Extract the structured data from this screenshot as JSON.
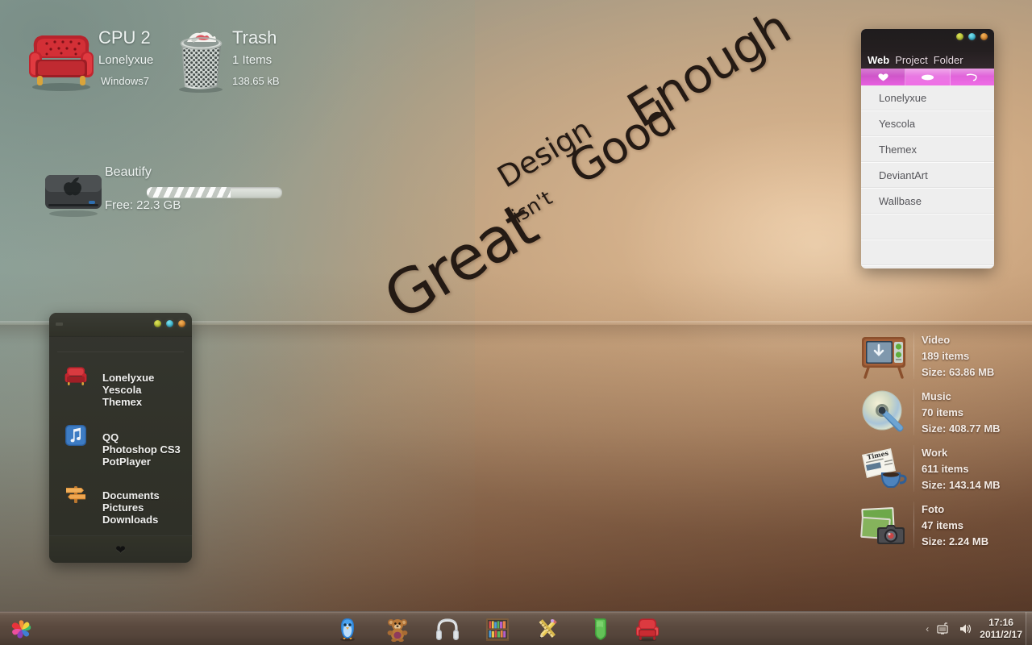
{
  "wallpaper": {
    "line_great": "Great",
    "line_design": "Design",
    "line_isnt": "isn't",
    "line_good": "Good",
    "line_enough": "Enough"
  },
  "desktop_widgets": {
    "cpu": {
      "icon": "armchair-icon",
      "title": "CPU 2",
      "user": "Lonelyxue",
      "os": "Windows7"
    },
    "trash": {
      "icon": "trash-can-icon",
      "title": "Trash",
      "items": "1 Items",
      "size": "138.65 kB"
    },
    "drive": {
      "icon": "hard-drive-icon",
      "title": "Beautify",
      "free": "Free: 22.3 GB",
      "used_percent": 62
    }
  },
  "launcher": {
    "footer_icon": "heart-icon",
    "groups": [
      {
        "icon": "armchair-icon",
        "items": [
          "Lonelyxue",
          "Yescola",
          "Themex"
        ]
      },
      {
        "icon": "music-note-icon",
        "items": [
          "QQ",
          "Photoshop CS3",
          "PotPlayer"
        ]
      },
      {
        "icon": "signpost-icon",
        "items": [
          "Documents",
          "Pictures",
          "Downloads"
        ]
      }
    ],
    "window_dots": [
      "green",
      "cyan",
      "orange"
    ]
  },
  "bookmarks": {
    "tabs": [
      {
        "label": "Web",
        "active": true
      },
      {
        "label": "Project",
        "active": false
      },
      {
        "label": "Folder",
        "active": false
      }
    ],
    "tab_icons": [
      "heart-icon",
      "oval-icon",
      "swoosh-icon"
    ],
    "window_dots": [
      "green",
      "cyan",
      "orange"
    ],
    "rows": [
      "Lonelyxue",
      "Yescola",
      "Themex",
      "DeviantArt",
      "Wallbase"
    ],
    "empty_rows": 2
  },
  "folder_stats": [
    {
      "icon": "tv-icon",
      "name": "Video",
      "items": "189 items",
      "size": "Size: 63.86 MB"
    },
    {
      "icon": "cd-disc-icon",
      "name": "Music",
      "items": "70 items",
      "size": "Size: 408.77 MB"
    },
    {
      "icon": "newspaper-icon",
      "name": "Work",
      "items": "611 items",
      "size": "Size: 143.14 MB"
    },
    {
      "icon": "photos-icon",
      "name": "Foto",
      "items": "47 items",
      "size": "Size: 2.24 MB"
    }
  ],
  "taskbar": {
    "start_icon": "pinwheel-start-icon",
    "icons": [
      "penguin-icon",
      "teddy-bear-icon",
      "headphones-icon",
      "bookshelf-icon",
      "pencil-ruler-icon",
      "green-tag-icon",
      "armchair-icon"
    ],
    "tray": {
      "chevron": "‹",
      "icons": [
        "network-icon",
        "volume-icon"
      ],
      "time": "17:16",
      "date": "2011/2/17"
    }
  },
  "colors": {
    "accent_pink": "#e163da",
    "panel_dark": "#313229",
    "list_bg": "#eeeeee",
    "desktop_text": "#eef3f1"
  }
}
